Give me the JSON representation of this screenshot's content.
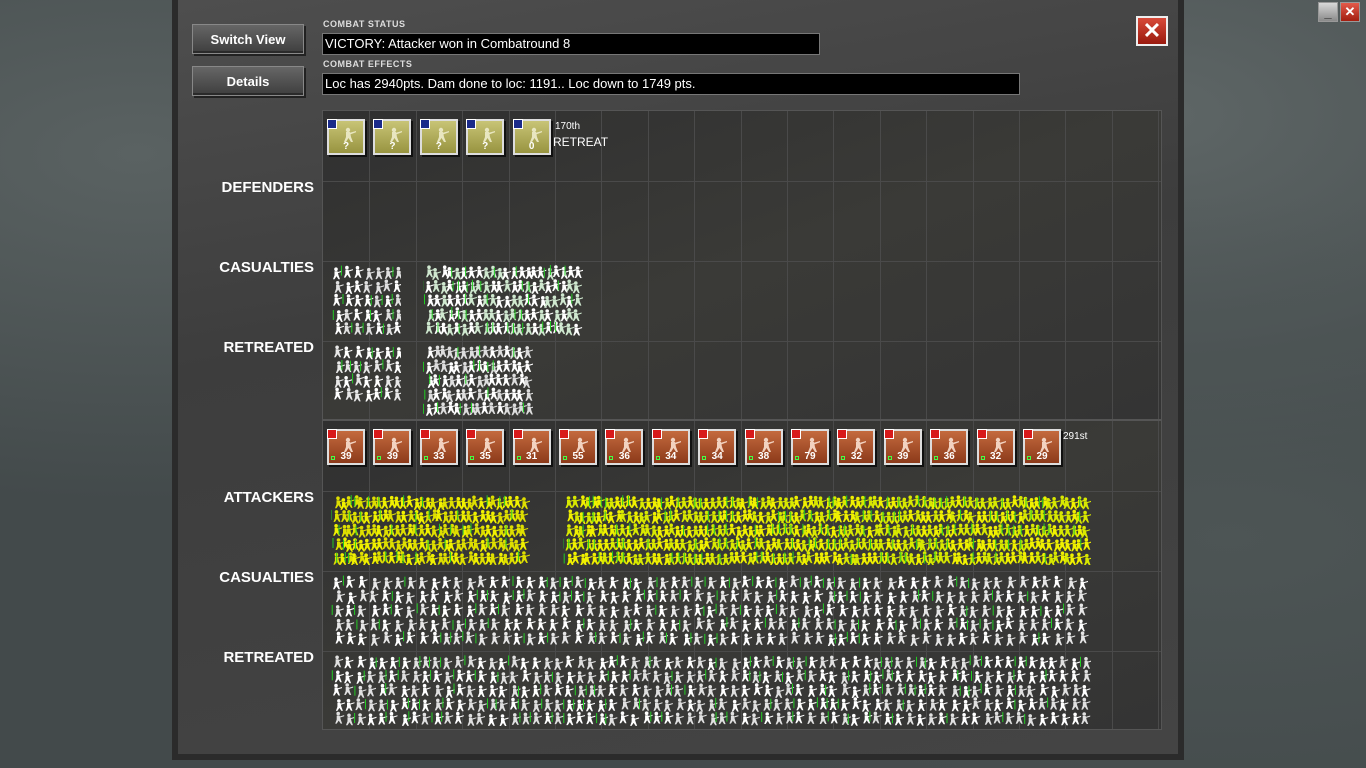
{
  "window": {
    "minimize_label": "_",
    "close_label": "✕"
  },
  "buttons": {
    "switch_view": "Switch View",
    "details": "Details",
    "close": "✕"
  },
  "combat_status": {
    "label": "COMBAT STATUS",
    "text": "VICTORY: Attacker won in Combatround  8"
  },
  "combat_effects": {
    "label": "COMBAT EFFECTS",
    "text": "Loc has  2940pts. Dam done to loc: 1191.. Loc down to 1749 pts."
  },
  "rows": {
    "defenders": "DEFENDERS",
    "def_casualties": "CASUALTIES",
    "def_retreated": "RETREATED",
    "attackers": "ATTACKERS",
    "att_casualties": "CASUALTIES",
    "att_retreated": "RETREATED"
  },
  "defender_units": [
    "?",
    "?",
    "?",
    "?",
    "0"
  ],
  "defender_unit_name": "170th",
  "defender_unit_status": "RETREAT",
  "attacker_units": [
    "39",
    "39",
    "33",
    "35",
    "31",
    "55",
    "36",
    "34",
    "34",
    "38",
    "79",
    "32",
    "39",
    "36",
    "32",
    "29"
  ],
  "attacker_unit_name": "291st",
  "colors": {
    "defender": "#b8b45a",
    "attacker": "#b05028",
    "strength_flash": "#f0f000"
  },
  "icons": [
    "minimize-icon",
    "close-icon",
    "infantry-icon",
    "national-flag-icon"
  ]
}
